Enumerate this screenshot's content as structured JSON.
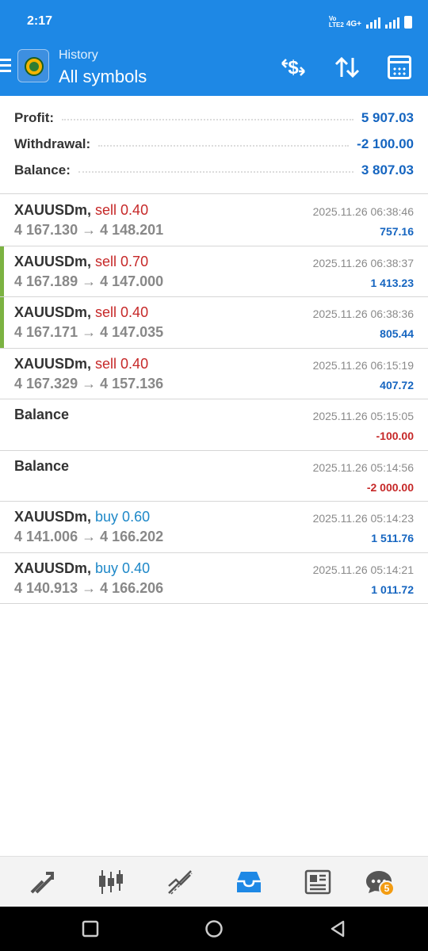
{
  "status_bar": {
    "time": "2:17",
    "network": "4G+",
    "volte": "Vo LTE2"
  },
  "header": {
    "subtitle": "History",
    "title": "All symbols",
    "actions": [
      "dollar-exchange-icon",
      "sort-icon",
      "calendar-icon"
    ]
  },
  "summary": {
    "profit_label": "Profit:",
    "profit_value": "5 907.03",
    "withdrawal_label": "Withdrawal:",
    "withdrawal_value": "-2 100.00",
    "balance_label": "Balance:",
    "balance_value": "3 807.03"
  },
  "deals": [
    {
      "symbol": "XAUUSDm,",
      "side": "sell 0.40",
      "prices": "4 167.130 → 4 148.201",
      "datetime": "2025.11.26 06:38:46",
      "amount": "757.16"
    },
    {
      "symbol": "XAUUSDm,",
      "side": "sell 0.70",
      "prices": "4 167.189 → 4 147.000",
      "datetime": "2025.11.26 06:38:37",
      "amount": "1 413.23"
    },
    {
      "symbol": "XAUUSDm,",
      "side": "sell 0.40",
      "prices": "4 167.171 → 4 147.035",
      "datetime": "2025.11.26 06:38:36",
      "amount": "805.44"
    },
    {
      "symbol": "XAUUSDm,",
      "side": "sell 0.40",
      "prices": "4 167.329 → 4 157.136",
      "datetime": "2025.11.26 06:15:19",
      "amount": "407.72"
    },
    {
      "symbol": "Balance",
      "side": "",
      "prices": "",
      "datetime": "2025.11.26 05:15:05",
      "amount": "-100.00"
    },
    {
      "symbol": "Balance",
      "side": "",
      "prices": "",
      "datetime": "2025.11.26 05:14:56",
      "amount": "-2 000.00"
    },
    {
      "symbol": "XAUUSDm,",
      "side": "buy 0.60",
      "prices": "4 141.006 → 4 166.202",
      "datetime": "2025.11.26 05:14:23",
      "amount": "1 511.76"
    },
    {
      "symbol": "XAUUSDm,",
      "side": "buy 0.40",
      "prices": "4 140.913 → 4 166.206",
      "datetime": "2025.11.26 05:14:21",
      "amount": "1 011.72"
    }
  ],
  "bottom_nav": {
    "items": [
      "trade-arrows-icon",
      "candlestick-icon",
      "chart-line-icon",
      "inbox-history-icon",
      "news-icon",
      "chat-icon"
    ],
    "chat_badge": "5"
  },
  "colors": {
    "accent": "#1e88e5",
    "sell": "#c62828",
    "buy": "#1e88c8",
    "positive": "#1565c0",
    "negative": "#c62828",
    "marker": "#7cb342"
  }
}
